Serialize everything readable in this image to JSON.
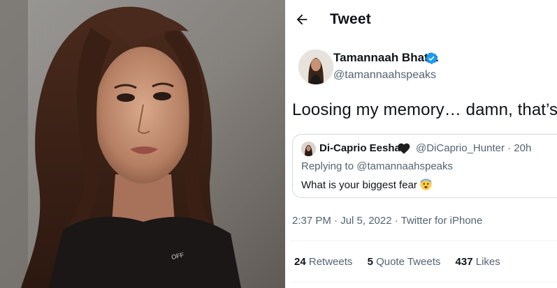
{
  "header": {
    "title": "Tweet",
    "back_icon": "arrow-left-icon"
  },
  "author": {
    "display_name": "Tamannaah Bhatia",
    "handle": "@tamannaahspeaks",
    "verified_icon": "verified-badge-icon",
    "badge_color": "#1d9bf0"
  },
  "tweet": {
    "text": "Loosing my memory… damn, that’s so"
  },
  "quote": {
    "name": "Di-Caprio Eesha",
    "heart_icon": "black-heart-icon",
    "handle_time": "@DiCaprio_Hunter · 20h",
    "replying": "Replying to @tamannaahspeaks",
    "text": "What is your biggest fear",
    "emoji_icon": "fearful-face-icon"
  },
  "meta": {
    "timestamp": "2:37 PM · Jul 5, 2022 · Twitter for iPhone"
  },
  "stats": {
    "retweets_count": "24",
    "retweets_label": "Retweets",
    "quotes_count": "5",
    "quotes_label": "Quote Tweets",
    "likes_count": "437",
    "likes_label": "Likes"
  }
}
